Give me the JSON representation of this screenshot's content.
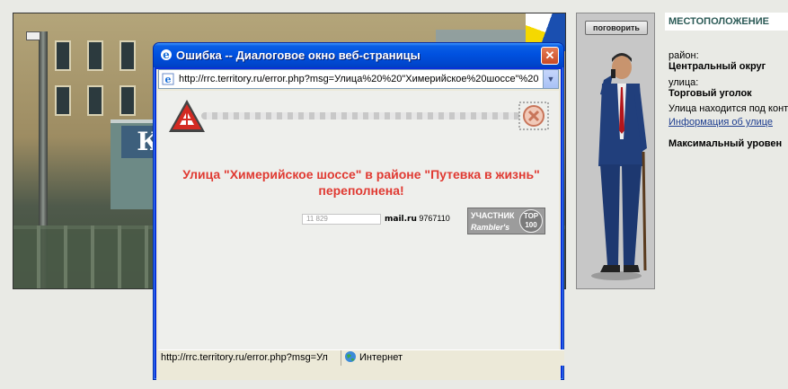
{
  "dialog": {
    "title": "Ошибка -- Диалоговое окно веб-страницы",
    "close_glyph": "✕",
    "address": "http://rrc.territory.ru/error.php?msg=Улица%20%20\"Химерийское%20шоссе\"%20",
    "message_line1": "Улица \"Химерийское шоссе\" в районе \"Путевка в жизнь\"",
    "message_line2": "переполнена!",
    "counters": {
      "hit_counter": "11 829",
      "mailru_label": "mail.ru",
      "mailru_number": "9767110",
      "rambler_top": "УЧАСТНИК",
      "rambler_bottom": "Rambler's",
      "rambler_badge": "TOP 100"
    },
    "status_url": "http://rrc.territory.ru/error.php?msg=Ул",
    "status_zone": "Интернет"
  },
  "talk_panel": {
    "button_label": "поговорить"
  },
  "info": {
    "header": "МЕСТОПОЛОЖЕНИЕ",
    "district_label": "район:",
    "district_value": "Центральный округ",
    "street_label": "улица:",
    "street_value": "Торговый уголок",
    "street_note": "Улица находится под конт",
    "street_link": "Информация об улице",
    "max_level": "Максимальный уровен"
  },
  "scene": {
    "shop_sign": "К"
  },
  "colors": {
    "error_text": "#e03a32",
    "xp_title": "#0051e0",
    "header_teal": "#2b5a56"
  }
}
